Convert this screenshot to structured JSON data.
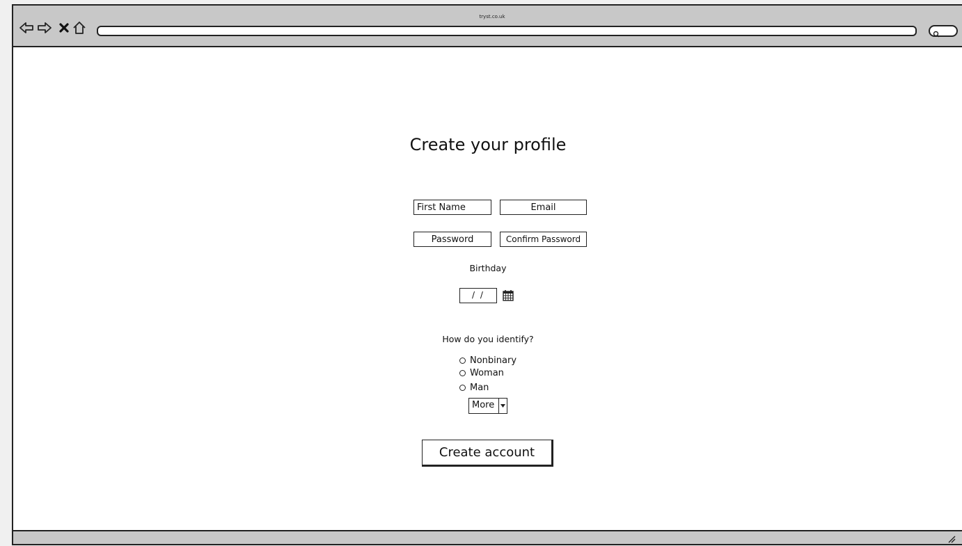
{
  "browser": {
    "url_caption": "tryst.co.uk",
    "nav_icons": [
      "back-arrow-icon",
      "forward-arrow-icon",
      "close-icon",
      "home-icon"
    ],
    "search_icon": "search-icon"
  },
  "page": {
    "title": "Create your profile"
  },
  "form": {
    "first_name_placeholder": "First Name",
    "email_placeholder": "Email",
    "password_placeholder": "Password",
    "confirm_password_placeholder": "Confirm Password",
    "birthday_label": "Birthday",
    "birthday_value": "/ /",
    "calendar_icon": "calendar-icon",
    "identify_label": "How do you identify?",
    "identity_options": [
      "Nonbinary",
      "Woman",
      "Man"
    ],
    "more_select_value": "More",
    "submit_label": "Create account"
  }
}
